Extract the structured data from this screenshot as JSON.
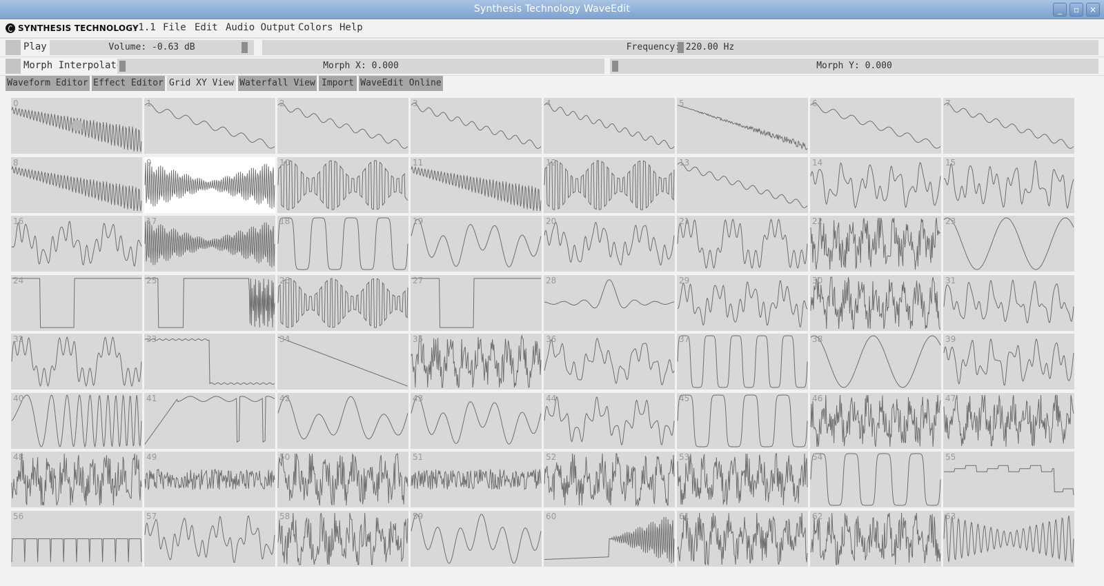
{
  "window": {
    "title": "Synthesis Technology WaveEdit"
  },
  "window_controls": [
    "_",
    "▫",
    "×"
  ],
  "menubar": {
    "logo_text": "SYNTHESIS TECHNOLOGY",
    "version": "v1.1",
    "items": [
      "File",
      "Edit",
      "Audio Output",
      "Colors",
      "Help"
    ]
  },
  "controls": {
    "play_label": "Play",
    "volume_label": "Volume: -0.63 dB",
    "volume_level": 0.98,
    "frequency_label": "Frequency: 220.00 Hz",
    "frequency_level": 0.5,
    "morph_interpolate_label": "Morph Interpolate",
    "morph_x_label": "Morph X: 0.000",
    "morph_x_level": 0.0,
    "morph_y_label": "Morph Y: 0.000",
    "morph_y_level": 0.0
  },
  "tabs": [
    {
      "label": "Waveform Editor",
      "active": false
    },
    {
      "label": "Effect Editor",
      "active": false
    },
    {
      "label": "Grid XY View",
      "active": true
    },
    {
      "label": "Waterfall View",
      "active": false
    },
    {
      "label": "Import",
      "active": false
    },
    {
      "label": "WaveEdit Online",
      "active": false
    }
  ],
  "grid": {
    "columns": 8,
    "rows": 8,
    "selected_index": 9,
    "labels": [
      "0",
      "1",
      "2",
      "3",
      "4",
      "5",
      "6",
      "7",
      "8",
      "9",
      "10",
      "11",
      "12",
      "13",
      "14",
      "15",
      "16",
      "17",
      "18",
      "19",
      "20",
      "21",
      "22",
      "23",
      "24",
      "25",
      "26",
      "27",
      "28",
      "29",
      "30",
      "31",
      "32",
      "33",
      "34",
      "35",
      "36",
      "37",
      "38",
      "39",
      "40",
      "41",
      "42",
      "43",
      "44",
      "45",
      "46",
      "47",
      "48",
      "49",
      "50",
      "51",
      "52",
      "53",
      "54",
      "55",
      "56",
      "57",
      "58",
      "59",
      "60",
      "61",
      "62",
      "63"
    ],
    "waves": [
      "saw-dense",
      "saw-wobble",
      "saw-wobble",
      "saw-wobble",
      "saw-wobble",
      "saw-noisy",
      "saw-wobble",
      "saw-wobble",
      "saw-dense",
      "burst",
      "dense-pulse",
      "saw-dense",
      "dense-pulse",
      "saw-wobble",
      "harmonic",
      "harmonic",
      "harmonic",
      "burst",
      "square-soft",
      "sine-mix",
      "harmonic",
      "square-mix",
      "dense-noise",
      "sine-slow",
      "square-wide",
      "square-burst",
      "dense-pulse",
      "square-wide",
      "sinc",
      "harmonic",
      "dense-noise",
      "harmonic",
      "square-mix",
      "square-drop",
      "ramp-down",
      "dense-noise",
      "harmonic",
      "square-soft",
      "sine-slow",
      "harmonic",
      "chirp",
      "square-ring",
      "sine-mix",
      "sine-mix",
      "harmonic",
      "square-soft",
      "dense-noise",
      "dense-noise",
      "dense-noise",
      "noise-band",
      "dense-noise",
      "noise-band",
      "dense-noise",
      "dense-noise",
      "square-soft",
      "steps",
      "spikes",
      "harmonic",
      "dense-noise",
      "sine-mix",
      "rise-burst",
      "dense-noise",
      "dense-noise",
      "sine-fast"
    ]
  },
  "colors": {
    "waveform": "#6e6e6e",
    "cell_bg": "#d8d8d8",
    "cell_selected_bg": "#ffffff",
    "tab_bg": "#a6a6a6",
    "tab_active_bg": "#d8d8d8",
    "titlebar": "#8fb0d9"
  }
}
